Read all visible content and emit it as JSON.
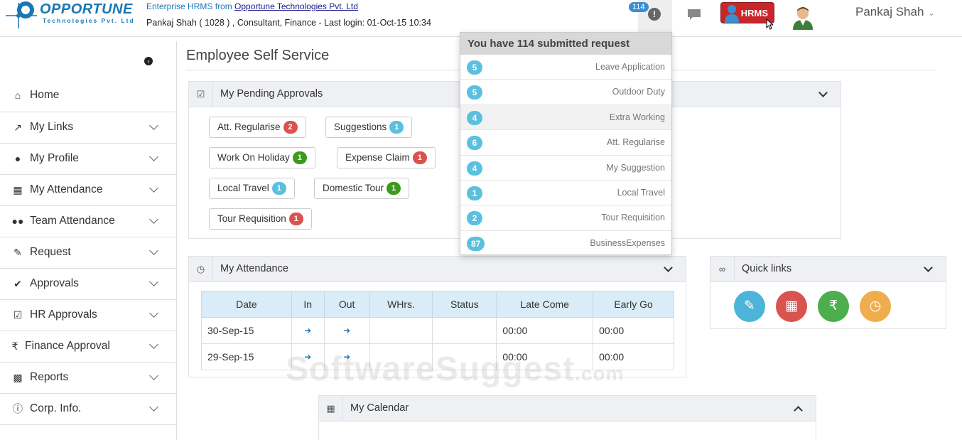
{
  "header": {
    "logo_brand": "OPPORTUNE",
    "logo_sub": "Technologies Pvt. Ltd",
    "tagline_prefix": "Enterprise HRMS from ",
    "tagline_link": "Opportune Technologies Pvt. Ltd",
    "user_info": "Pankaj Shah ( 1028 ) , Consultant, Finance - Last login: 01-Oct-15 10:34",
    "notification_count": "114",
    "hrms_label": "HRMS",
    "username": "Pankaj Shah"
  },
  "sidebar": {
    "items": [
      {
        "label": "Home",
        "icon": "home-icon"
      },
      {
        "label": "My Links",
        "icon": "external-link-icon"
      },
      {
        "label": "My Profile",
        "icon": "user-icon"
      },
      {
        "label": "My Attendance",
        "icon": "calendar-icon"
      },
      {
        "label": "Team Attendance",
        "icon": "users-icon"
      },
      {
        "label": "Request",
        "icon": "edit-icon"
      },
      {
        "label": "Approvals",
        "icon": "check-icon"
      },
      {
        "label": "HR Approvals",
        "icon": "check-square-icon"
      },
      {
        "label": "Finance Approval",
        "icon": "rupee-icon"
      },
      {
        "label": "Reports",
        "icon": "bar-chart-icon"
      },
      {
        "label": "Corp. Info.",
        "icon": "info-icon"
      }
    ]
  },
  "main": {
    "page_title": "Employee Self Service",
    "pending": {
      "title": "My Pending Approvals",
      "chips": [
        {
          "label": "Att. Regularise",
          "count": "2",
          "color": "#d9534f"
        },
        {
          "label": "Suggestions",
          "count": "1",
          "color": "#5bc0de"
        },
        {
          "label": "Work On Holiday",
          "count": "1",
          "color": "#3c9a1e"
        },
        {
          "label": "Expense Claim",
          "count": "1",
          "color": "#d9534f"
        },
        {
          "label": "Local Travel",
          "count": "1",
          "color": "#5bc0de"
        },
        {
          "label": "Domestic Tour",
          "count": "1",
          "color": "#3c9a1e"
        },
        {
          "label": "Tour Requisition",
          "count": "1",
          "color": "#d9534f"
        }
      ]
    },
    "attendance": {
      "title": "My Attendance",
      "columns": [
        "Date",
        "In",
        "Out",
        "WHrs.",
        "Status",
        "Late Come",
        "Early Go"
      ],
      "rows": [
        {
          "date": "30-Sep-15",
          "whrs": "",
          "status": "",
          "late": "00:00",
          "early": "00:00"
        },
        {
          "date": "29-Sep-15",
          "whrs": "",
          "status": "",
          "late": "00:00",
          "early": "00:00"
        }
      ]
    },
    "quick_links": {
      "title": "Quick links",
      "links": [
        {
          "icon": "edit-icon",
          "color": "#4cb4d8"
        },
        {
          "icon": "calendar-icon",
          "color": "#d9534f"
        },
        {
          "icon": "rupee-icon",
          "color": "#4cae4c"
        },
        {
          "icon": "clock-icon",
          "color": "#f0ad4e"
        }
      ]
    },
    "calendar": {
      "title": "My Calendar"
    }
  },
  "dropdown": {
    "heading": "You have 114 submitted request",
    "items": [
      {
        "count": "5",
        "label": "Leave Application"
      },
      {
        "count": "5",
        "label": "Outdoor Duty"
      },
      {
        "count": "4",
        "label": "Extra Working"
      },
      {
        "count": "6",
        "label": "Att. Regularise"
      },
      {
        "count": "4",
        "label": "My Suggestion"
      },
      {
        "count": "1",
        "label": "Local Travel"
      },
      {
        "count": "2",
        "label": "Tour Requisition"
      },
      {
        "count": "87",
        "label": "BusinessExpenses"
      }
    ]
  },
  "watermark": {
    "main": "SoftwareSuggest",
    "suffix": ".com"
  }
}
